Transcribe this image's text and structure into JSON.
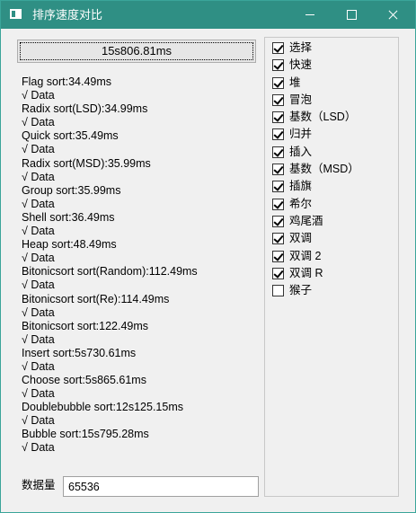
{
  "window": {
    "title": "排序速度对比"
  },
  "run_button": {
    "label": "15s806.81ms"
  },
  "results": [
    {
      "line": "Flag sort:34.49ms",
      "data": "√ Data"
    },
    {
      "line": "Radix sort(LSD):34.99ms",
      "data": "√ Data"
    },
    {
      "line": "Quick sort:35.49ms",
      "data": "√ Data"
    },
    {
      "line": "Radix sort(MSD):35.99ms",
      "data": "√ Data"
    },
    {
      "line": "Group sort:35.99ms",
      "data": "√ Data"
    },
    {
      "line": "Shell sort:36.49ms",
      "data": "√ Data"
    },
    {
      "line": "Heap sort:48.49ms",
      "data": "√ Data"
    },
    {
      "line": "Bitonicsort sort(Random):112.49ms",
      "data": "√ Data"
    },
    {
      "line": "Bitonicsort sort(Re):114.49ms",
      "data": "√ Data"
    },
    {
      "line": "Bitonicsort sort:122.49ms",
      "data": "√ Data"
    },
    {
      "line": "Insert sort:5s730.61ms",
      "data": "√ Data"
    },
    {
      "line": "Choose sort:5s865.61ms",
      "data": "√ Data"
    },
    {
      "line": "Doublebubble sort:12s125.15ms",
      "data": "√ Data"
    },
    {
      "line": "Bubble sort:15s795.28ms",
      "data": "√ Data"
    }
  ],
  "data_size": {
    "label": "数据量",
    "value": "65536"
  },
  "algorithms": [
    {
      "label": "选择",
      "checked": true
    },
    {
      "label": "快速",
      "checked": true
    },
    {
      "label": "堆",
      "checked": true
    },
    {
      "label": "冒泡",
      "checked": true
    },
    {
      "label": "基数（LSD）",
      "checked": true
    },
    {
      "label": "归并",
      "checked": true
    },
    {
      "label": "插入",
      "checked": true
    },
    {
      "label": "基数（MSD）",
      "checked": true
    },
    {
      "label": "插旗",
      "checked": true
    },
    {
      "label": "希尔",
      "checked": true
    },
    {
      "label": "鸡尾酒",
      "checked": true
    },
    {
      "label": "双调",
      "checked": true
    },
    {
      "label": "双调 2",
      "checked": true
    },
    {
      "label": "双调 R",
      "checked": true
    },
    {
      "label": "猴子",
      "checked": false
    }
  ]
}
